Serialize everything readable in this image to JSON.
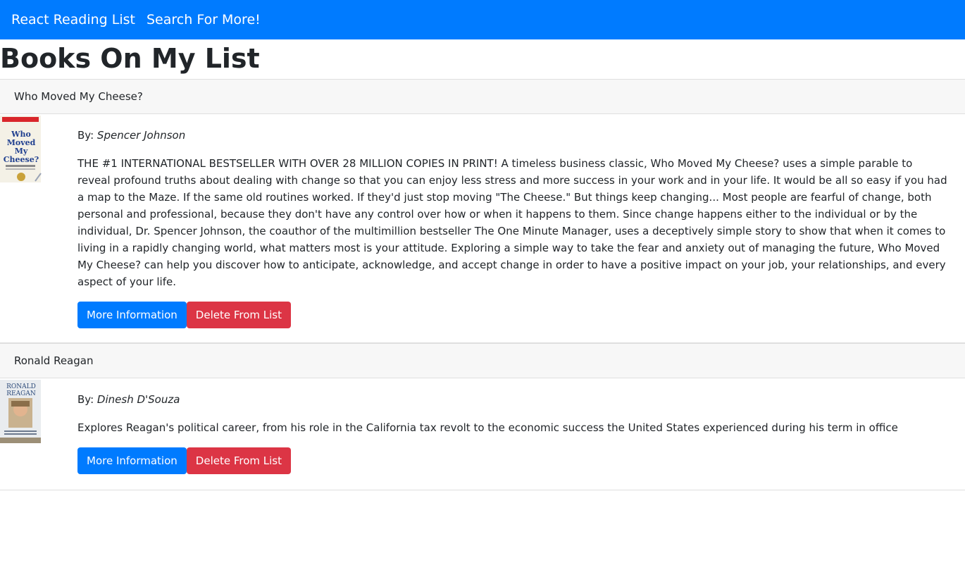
{
  "navbar": {
    "brand": "React Reading List",
    "search_link": "Search For More!"
  },
  "page_title": "Books On My List",
  "books": [
    {
      "title": "Who Moved My Cheese?",
      "by_label": "By:",
      "author": "Spencer Johnson",
      "description": "THE #1 INTERNATIONAL BESTSELLER WITH OVER 28 MILLION COPIES IN PRINT! A timeless business classic, Who Moved My Cheese? uses a simple parable to reveal profound truths about dealing with change so that you can enjoy less stress and more success in your work and in your life. It would be all so easy if you had a map to the Maze. If the same old routines worked. If they'd just stop moving \"The Cheese.\" But things keep changing... Most people are fearful of change, both personal and professional, because they don't have any control over how or when it happens to them. Since change happens either to the individual or by the individual, Dr. Spencer Johnson, the coauthor of the multimillion bestseller The One Minute Manager, uses a deceptively simple story to show that when it comes to living in a rapidly changing world, what matters most is your attitude. Exploring a simple way to take the fear and anxiety out of managing the future, Who Moved My Cheese? can help you discover how to anticipate, acknowledge, and accept change in order to have a positive impact on your job, your relationships, and every aspect of your life.",
      "cover_text": [
        "Who",
        "Moved",
        "My",
        "Cheese?"
      ],
      "more_info_label": "More Information",
      "delete_label": "Delete From List"
    },
    {
      "title": "Ronald Reagan",
      "by_label": "By:",
      "author": "Dinesh D'Souza",
      "description": "Explores Reagan's political career, from his role in the California tax revolt to the economic success the United States experienced during his term in office",
      "cover_text": [
        "RONALD",
        "REAGAN"
      ],
      "more_info_label": "More Information",
      "delete_label": "Delete From List"
    }
  ],
  "colors": {
    "primary": "#007bff",
    "danger": "#dc3545"
  }
}
